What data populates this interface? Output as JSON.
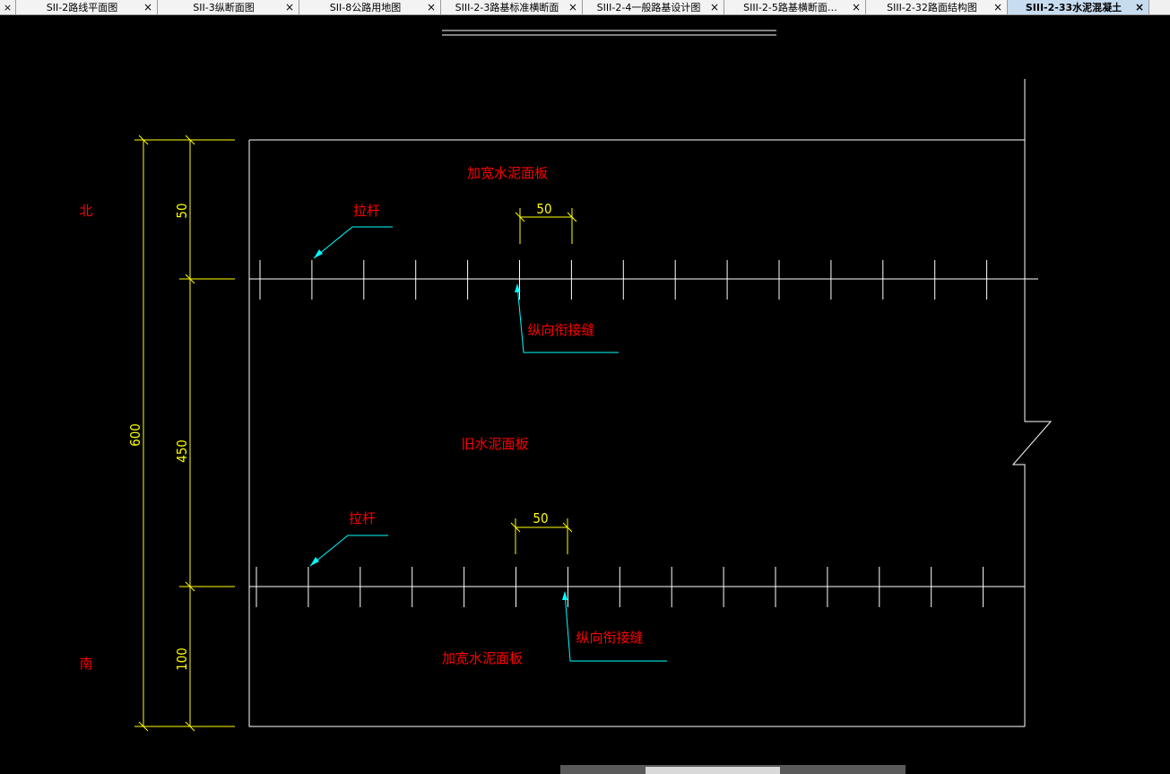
{
  "tabs": [
    {
      "label": "SII-2路线平面图",
      "active": false
    },
    {
      "label": "SII-3纵断面图",
      "active": false
    },
    {
      "label": "SII-8公路用地图",
      "active": false
    },
    {
      "label": "SIII-2-3路基标准横断面",
      "active": false
    },
    {
      "label": "SIII-2-4一般路基设计图",
      "active": false
    },
    {
      "label": "SIII-2-5路基横断面…",
      "active": false
    },
    {
      "label": "SIII-2-32路面结构图",
      "active": false
    },
    {
      "label": "SIII-2-33水泥混凝土",
      "active": true
    }
  ],
  "tab_close_glyph": "×",
  "tab_lead_glyph": "×",
  "drawing": {
    "north_label": "北",
    "south_label": "南",
    "top_slab_label": "加宽水泥面板",
    "old_slab_label": "旧水泥面板",
    "bottom_slab_label": "加宽水泥面板",
    "tie_bar_label_1": "拉杆",
    "tie_bar_label_2": "拉杆",
    "joint_label_1": "纵向衔接缝",
    "joint_label_2": "纵向衔接缝",
    "dim_total": "600",
    "dim_top": "50",
    "dim_mid": "450",
    "dim_bottom": "100",
    "spacing_1": "50",
    "spacing_2": "50"
  },
  "colors": {
    "line": "#ffffff",
    "dimension": "#ffff00",
    "label": "#ff0000",
    "leader": "#00ffff"
  }
}
